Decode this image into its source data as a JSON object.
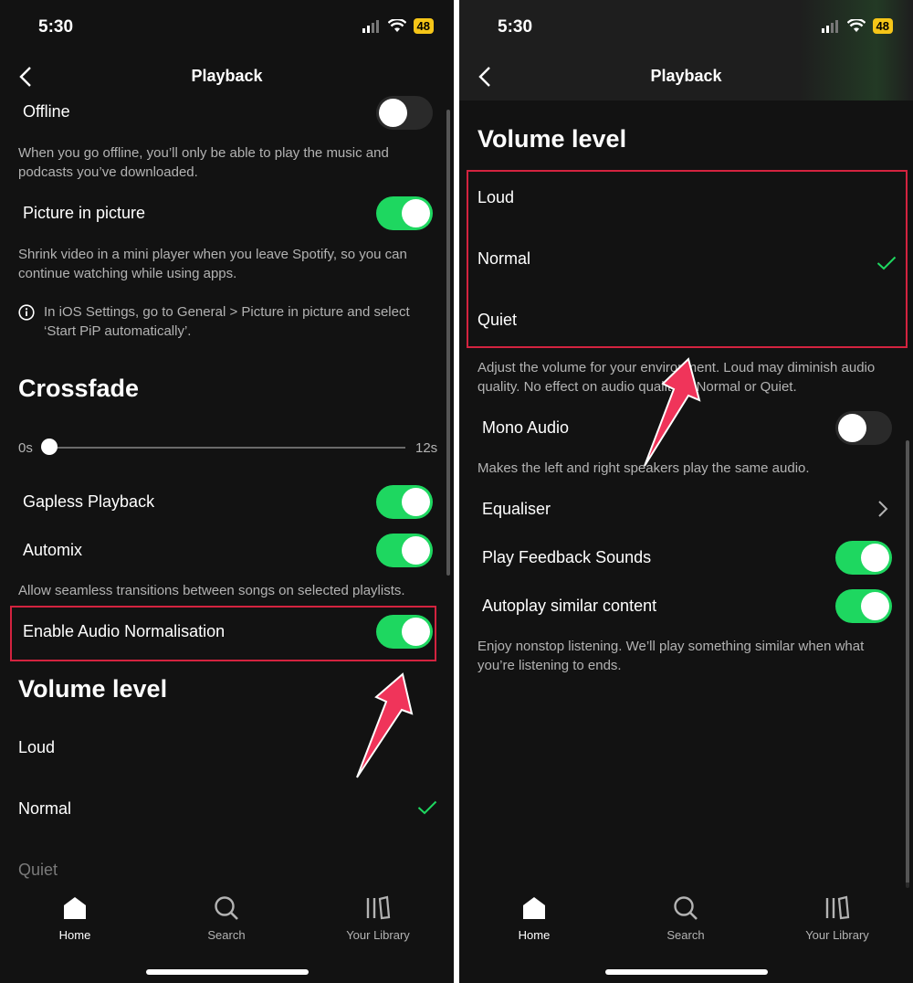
{
  "left": {
    "status": {
      "time": "5:30",
      "battery": "48"
    },
    "nav": {
      "title": "Playback"
    },
    "offline": {
      "label": "Offline",
      "desc": "When you go offline, you’ll only be able to play the music and podcasts you’ve downloaded.",
      "enabled": false
    },
    "pip": {
      "label": "Picture in picture",
      "desc": "Shrink video in a mini player when you leave Spotify, so you can continue watching while using apps.",
      "info": "In iOS Settings, go to General > Picture in picture and select ‘Start PiP automatically’.",
      "enabled": true
    },
    "crossfade": {
      "title": "Crossfade",
      "min": "0s",
      "max": "12s",
      "value_seconds": 0
    },
    "gapless": {
      "label": "Gapless Playback",
      "enabled": true
    },
    "automix": {
      "label": "Automix",
      "desc": "Allow seamless transitions between songs on selected playlists.",
      "enabled": true
    },
    "normalisation": {
      "label": "Enable Audio Normalisation",
      "enabled": true
    },
    "volume": {
      "title": "Volume level",
      "loud": "Loud",
      "normal": "Normal",
      "quiet": "Quiet",
      "selected": "Normal"
    }
  },
  "right": {
    "status": {
      "time": "5:30",
      "battery": "48"
    },
    "nav": {
      "title": "Playback"
    },
    "volume": {
      "title": "Volume level",
      "loud": "Loud",
      "normal": "Normal",
      "quiet": "Quiet",
      "selected": "Normal",
      "desc": "Adjust the volume for your environment. Loud may diminish audio quality. No effect on audio quality in Normal or Quiet."
    },
    "mono": {
      "label": "Mono Audio",
      "desc": "Makes the left and right speakers play the same audio.",
      "enabled": false
    },
    "equaliser": {
      "label": "Equaliser"
    },
    "feedback": {
      "label": "Play Feedback Sounds",
      "enabled": true
    },
    "autoplay": {
      "label": "Autoplay similar content",
      "desc": "Enjoy nonstop listening. We’ll play something similar when what you’re listening to ends.",
      "enabled": true
    }
  },
  "tabs": {
    "home": "Home",
    "search": "Search",
    "library": "Your Library"
  },
  "colors": {
    "accent": "#1ed760",
    "highlight": "#d3233f",
    "arrow": "#f0345a",
    "background": "#121212"
  }
}
